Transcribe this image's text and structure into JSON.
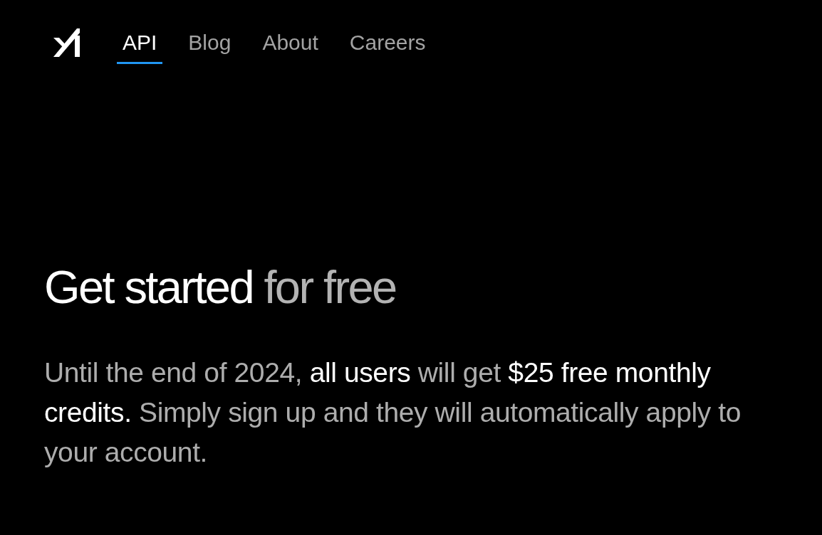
{
  "tabs": [
    {
      "label": "API",
      "selected": true
    },
    {
      "label": "Blog",
      "selected": false
    },
    {
      "label": "About",
      "selected": false
    },
    {
      "label": "Careers",
      "selected": false
    }
  ],
  "hero": {
    "title": "**Get started** for free",
    "body": "Until the end of 2024, **all users** will get **$25 free monthly credits.** Simply sign up and they will automatically apply to your account."
  }
}
